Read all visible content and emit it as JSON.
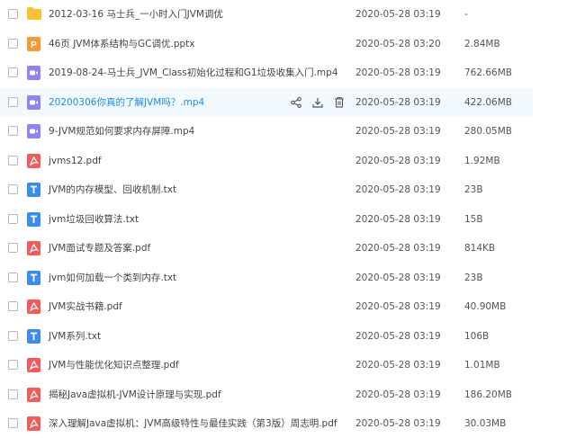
{
  "files": [
    {
      "name": "2012-03-16 马士兵_一小时入门JVM调优",
      "date": "2020-05-28 03:19",
      "size": "-",
      "type": "folder"
    },
    {
      "name": "46页 JVM体系结构与GC调优.pptx",
      "date": "2020-05-28 03:20",
      "size": "2.84MB",
      "type": "pptx"
    },
    {
      "name": "2019-08-24-马士兵_JVM_Class初始化过程和G1垃圾收集入门.mp4",
      "date": "2020-05-28 03:19",
      "size": "762.66MB",
      "type": "video"
    },
    {
      "name": "20200306你真的了解JVM吗？.mp4",
      "date": "2020-05-28 03:19",
      "size": "422.06MB",
      "type": "video"
    },
    {
      "name": "9-JVM规范如何要求内存屏障.mp4",
      "date": "2020-05-28 03:19",
      "size": "280.05MB",
      "type": "video"
    },
    {
      "name": "jvms12.pdf",
      "date": "2020-05-28 03:19",
      "size": "1.92MB",
      "type": "pdf"
    },
    {
      "name": "JVM的内存模型、回收机制.txt",
      "date": "2020-05-28 03:19",
      "size": "23B",
      "type": "txt"
    },
    {
      "name": "jvm垃圾回收算法.txt",
      "date": "2020-05-28 03:19",
      "size": "15B",
      "type": "txt"
    },
    {
      "name": "JVM面试专题及答案.pdf",
      "date": "2020-05-28 03:19",
      "size": "814KB",
      "type": "pdf"
    },
    {
      "name": "jvm如何加载一个类到内存.txt",
      "date": "2020-05-28 03:19",
      "size": "23B",
      "type": "txt"
    },
    {
      "name": "JVM实战书籍.pdf",
      "date": "2020-05-28 03:19",
      "size": "40.90MB",
      "type": "pdf"
    },
    {
      "name": "JVM系列.txt",
      "date": "2020-05-28 03:19",
      "size": "106B",
      "type": "txt"
    },
    {
      "name": "JVM与性能优化知识点整理.pdf",
      "date": "2020-05-28 03:19",
      "size": "1.01MB",
      "type": "pdf"
    },
    {
      "name": "揭秘Java虚拟机-JVM设计原理与实现.pdf",
      "date": "2020-05-28 03:19",
      "size": "186.20MB",
      "type": "pdf"
    },
    {
      "name": "深入理解Java虚拟机：JVM高级特性与最佳实践（第3版）周志明.pdf",
      "date": "2020-05-28 03:19",
      "size": "30.03MB",
      "type": "pdf"
    }
  ],
  "hover_index": 3,
  "row_actions": [
    "share-icon",
    "download-icon",
    "delete-icon"
  ],
  "colors": {
    "folder": "#f7c231",
    "pptx": "#f39a3a",
    "video": "#8f83f2",
    "pdf": "#f05c5c",
    "txt": "#3c8cf0",
    "hover_bg": "#f1f8fe",
    "hover_text": "#1a8dee"
  }
}
